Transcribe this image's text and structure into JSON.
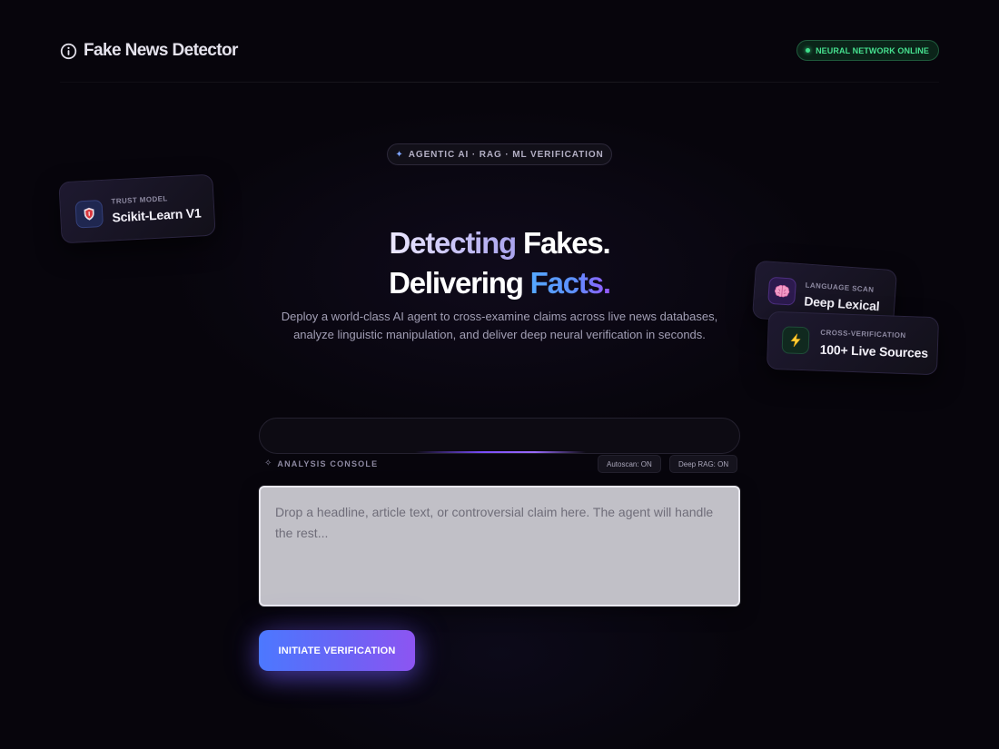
{
  "header": {
    "brand_icon": "info-circle-icon",
    "brand_title": "Fake News Detector",
    "status_text": "NEURAL NETWORK ONLINE",
    "status_color": "#46e08f"
  },
  "hero": {
    "tag_icon": "sparkle-icon",
    "tag_text": "AGENTIC AI · RAG · ML VERIFICATION",
    "headline_line1_a": "Detecting",
    "headline_line1_b": "Fakes.",
    "headline_line2_a": "Delivering",
    "headline_line2_b": "Facts.",
    "subtitle": "Deploy a world-class AI agent to cross-examine claims across live news databases, analyze linguistic manipulation, and deliver deep neural verification in seconds."
  },
  "cards": {
    "trust": {
      "icon": "shield-icon",
      "label": "TRUST MODEL",
      "value": "Scikit-Learn V1"
    },
    "language": {
      "icon": "brain-icon",
      "label": "LANGUAGE SCAN",
      "value": "Deep Lexical"
    },
    "cross": {
      "icon": "lightning-icon",
      "label": "CROSS-VERIFICATION",
      "value": "100+ Live Sources"
    }
  },
  "console": {
    "label_icon": "sparkle-icon",
    "label": "ANALYSIS CONSOLE",
    "autoscan": "Autoscan: ON",
    "deep_rag": "Deep RAG: ON",
    "progress": 0.4,
    "placeholder": "Drop a headline, article text, or controversial claim here. The agent will handle the rest...",
    "value": "",
    "submit_label": "INITIATE VERIFICATION"
  },
  "colors": {
    "background": "#07050c",
    "accent_blue": "#4c78ff",
    "accent_purple": "#8d55f2"
  }
}
